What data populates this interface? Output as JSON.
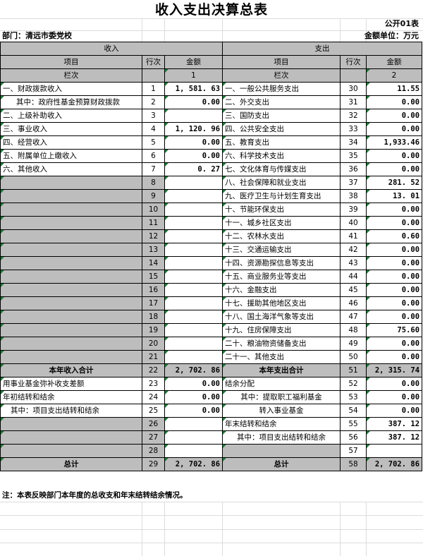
{
  "title": "收入支出决算总表",
  "header": {
    "form_code": "公开01表",
    "department": "部门：清远市委党校",
    "unit": "金额单位：万元"
  },
  "columns": {
    "income_section": "收入",
    "expense_section": "支出",
    "item": "项目",
    "row_no": "行次",
    "amount": "金额",
    "index_label": "栏次",
    "index_1": "1",
    "index_2": "2"
  },
  "rows": [
    {
      "li": "一、财政拨款收入",
      "ln": "1",
      "la": "1, 581. 63",
      "ri": "一、一般公共服务支出",
      "rn": "30",
      "ra": "11.55"
    },
    {
      "li": "其中：政府性基金预算财政拨款",
      "ln": "2",
      "la": "0.00",
      "ri": "二、外交支出",
      "rn": "31",
      "ra": "0.00",
      "lind": true
    },
    {
      "li": "二、上级补助收入",
      "ln": "3",
      "la": "",
      "ri": "三、国防支出",
      "rn": "32",
      "ra": "0.00"
    },
    {
      "li": "三、事业收入",
      "ln": "4",
      "la": "1, 120. 96",
      "ri": "四、公共安全支出",
      "rn": "33",
      "ra": "0.00"
    },
    {
      "li": "四、经营收入",
      "ln": "5",
      "la": "0.00",
      "ri": "五、教育支出",
      "rn": "34",
      "ra": "1,933.46"
    },
    {
      "li": "五、附属单位上缴收入",
      "ln": "6",
      "la": "0.00",
      "ri": "六、科学技术支出",
      "rn": "35",
      "ra": "0.00"
    },
    {
      "li": "六、其他收入",
      "ln": "7",
      "la": "0. 27",
      "ri": "七、文化体育与传媒支出",
      "rn": "36",
      "ra": "0.00"
    },
    {
      "li": "",
      "ln": "8",
      "la": "",
      "ri": "八、社会保障和就业支出",
      "rn": "37",
      "ra": "281. 52",
      "lgrey": true
    },
    {
      "li": "",
      "ln": "9",
      "la": "",
      "ri": "九、医疗卫生与计划生育支出",
      "rn": "38",
      "ra": "13. 01",
      "lgrey": true
    },
    {
      "li": "",
      "ln": "10",
      "la": "",
      "ri": "十、节能环保支出",
      "rn": "39",
      "ra": "0.00",
      "lgrey": true
    },
    {
      "li": "",
      "ln": "11",
      "la": "",
      "ri": "十一、城乡社区支出",
      "rn": "40",
      "ra": "0.00",
      "lgrey": true
    },
    {
      "li": "",
      "ln": "12",
      "la": "",
      "ri": "十二、农林水支出",
      "rn": "41",
      "ra": "0.60",
      "lgrey": true
    },
    {
      "li": "",
      "ln": "13",
      "la": "",
      "ri": "十三、交通运输支出",
      "rn": "42",
      "ra": "0.00",
      "lgrey": true
    },
    {
      "li": "",
      "ln": "14",
      "la": "",
      "ri": "十四、资源勘探信息等支出",
      "rn": "43",
      "ra": "0.00",
      "lgrey": true
    },
    {
      "li": "",
      "ln": "15",
      "la": "",
      "ri": "十五、商业服务业等支出",
      "rn": "44",
      "ra": "0.00",
      "lgrey": true
    },
    {
      "li": "",
      "ln": "16",
      "la": "",
      "ri": "十六、金融支出",
      "rn": "45",
      "ra": "0.00",
      "lgrey": true
    },
    {
      "li": "",
      "ln": "17",
      "la": "",
      "ri": "十七、援助其他地区支出",
      "rn": "46",
      "ra": "0.00",
      "lgrey": true
    },
    {
      "li": "",
      "ln": "18",
      "la": "",
      "ri": "十八、国土海洋气象等支出",
      "rn": "47",
      "ra": "0.00",
      "lgrey": true
    },
    {
      "li": "",
      "ln": "19",
      "la": "",
      "ri": "十九、住房保障支出",
      "rn": "48",
      "ra": "75.60",
      "lgrey": true
    },
    {
      "li": "",
      "ln": "20",
      "la": "",
      "ri": "二十、粮油物资储备支出",
      "rn": "49",
      "ra": "0.00",
      "lgrey": true
    },
    {
      "li": "",
      "ln": "21",
      "la": "",
      "ri": "二十一、其他支出",
      "rn": "50",
      "ra": "0.00",
      "lgrey": true
    },
    {
      "li": "本年收入合计",
      "ln": "22",
      "la": "2, 702. 86",
      "ri": "本年支出合计",
      "rn": "51",
      "ra": "2, 315. 74",
      "total": true
    },
    {
      "li": "用事业基金弥补收支差额",
      "ln": "23",
      "la": "0.00",
      "ri": "结余分配",
      "rn": "52",
      "ra": "0.00"
    },
    {
      "li": "年初结转和结余",
      "ln": "24",
      "la": "0.00",
      "ri": "其中：提取职工福利基金",
      "rn": "53",
      "ra": "0.00",
      "rind": true
    },
    {
      "li": "其中：项目支出结转和结余",
      "ln": "25",
      "la": "0.00",
      "ri": "转入事业基金",
      "rn": "54",
      "ra": "0.00",
      "lind2": true,
      "rind": true
    },
    {
      "li": "",
      "ln": "26",
      "la": "",
      "ri": "年末结转和结余",
      "rn": "55",
      "ra": "387. 12",
      "lgrey": true
    },
    {
      "li": "",
      "ln": "27",
      "la": "",
      "ri": "其中：项目支出结转和结余",
      "rn": "56",
      "ra": "387. 12",
      "lgrey": true,
      "rind": true
    },
    {
      "li": "",
      "ln": "28",
      "la": "",
      "ri": "",
      "rn": "57",
      "ra": "",
      "lgrey": true,
      "rgrey": true
    },
    {
      "li": "总计",
      "ln": "29",
      "la": "2, 702. 86",
      "ri": "总计",
      "rn": "58",
      "ra": "2, 702. 86",
      "total": true
    }
  ],
  "footnote": "注：本表反映部门本年度的总收支和年末结转结余情况。"
}
